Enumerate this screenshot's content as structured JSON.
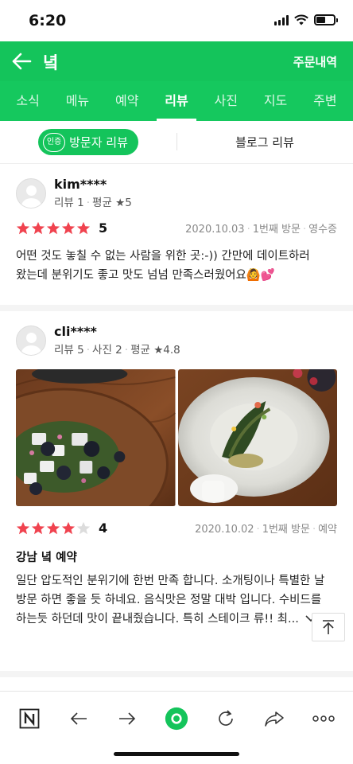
{
  "status": {
    "time": "6:20"
  },
  "header": {
    "title": "녘",
    "orders_label": "주문내역"
  },
  "tabs": [
    "소식",
    "메뉴",
    "예약",
    "리뷰",
    "사진",
    "지도",
    "주변"
  ],
  "active_tab": "리뷰",
  "review_switch": {
    "badge": "인증",
    "visitor_label": "방문자 리뷰",
    "blog_label": "블로그 리뷰"
  },
  "reviews": [
    {
      "username": "kim****",
      "stats_reviews": "리뷰 1",
      "stats_avg": "평균 ★5",
      "stars": 5,
      "score": "5",
      "date": "2020.10.03",
      "visit": "1번째 방문",
      "verify": "영수증",
      "text": "어떤 것도 놓칠 수 없는 사람을 위한 곳:-)) 간만에 데이트하러 왔는데 분위기도 좋고 맛도 넘넘 만족스러웠어요🙆💕"
    },
    {
      "username": "cli****",
      "stats_reviews": "리뷰 5",
      "stats_photos": "사진 2",
      "stats_avg": "평균 ★4.8",
      "stars": 4,
      "score": "4",
      "date": "2020.10.02",
      "visit": "1번째 방문",
      "verify": "예약",
      "title": "강남 녘 예약",
      "text": "일단 압도적인 분위기에 한번 만족 합니다. 소개팅이나 특별한 날 방문 하면 좋을 듯 하네요. 음식맛은 정말 대박 입니다. 수비드를 하는듯 하던데 맛이 끝내줬습니다. 특히 스테이크 류!! 최...",
      "photos": [
        "salad-photo",
        "plated-dish-photo"
      ]
    }
  ],
  "colors": {
    "brand_green": "#14c45b",
    "star_red": "#f0434f",
    "star_empty": "#dcdcdc"
  }
}
